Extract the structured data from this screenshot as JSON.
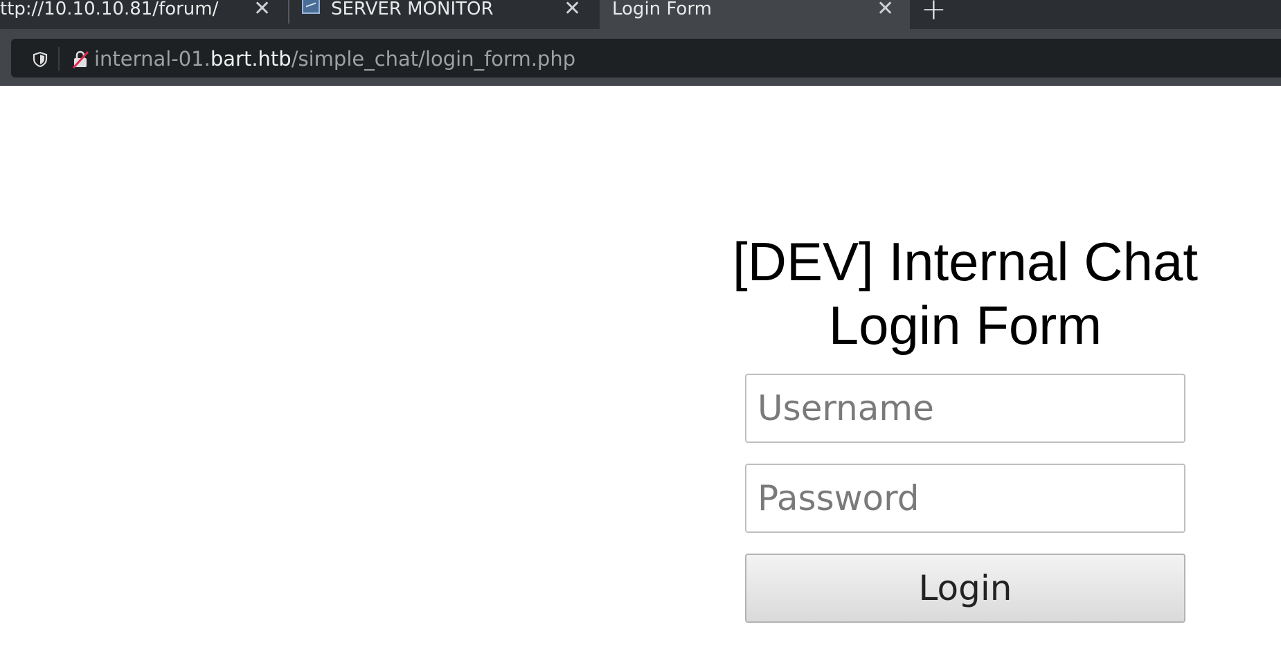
{
  "browser": {
    "tabs": [
      {
        "label": "ttp://10.10.10.81/forum/",
        "close": "✕"
      },
      {
        "label": "SERVER MONITOR",
        "close": "✕",
        "favicon": "chart-favicon-icon"
      },
      {
        "label": "Login Form",
        "close": "✕",
        "active": true
      }
    ],
    "new_tab": "+",
    "address": {
      "prefix": "internal-01.",
      "domain": "bart.htb",
      "path": "/simple_chat/login_form.php",
      "icons": [
        "shield-icon",
        "insecure-lock-icon"
      ]
    }
  },
  "page": {
    "title_line1": "[DEV] Internal Chat",
    "title_line2": "Login Form",
    "username_placeholder": "Username",
    "password_placeholder": "Password",
    "login_label": "Login"
  },
  "colors": {
    "tabbar": "#2b2f33",
    "active_tab": "#42464b",
    "urlbar": "#1e2124",
    "insecure_slash": "#e22850"
  }
}
